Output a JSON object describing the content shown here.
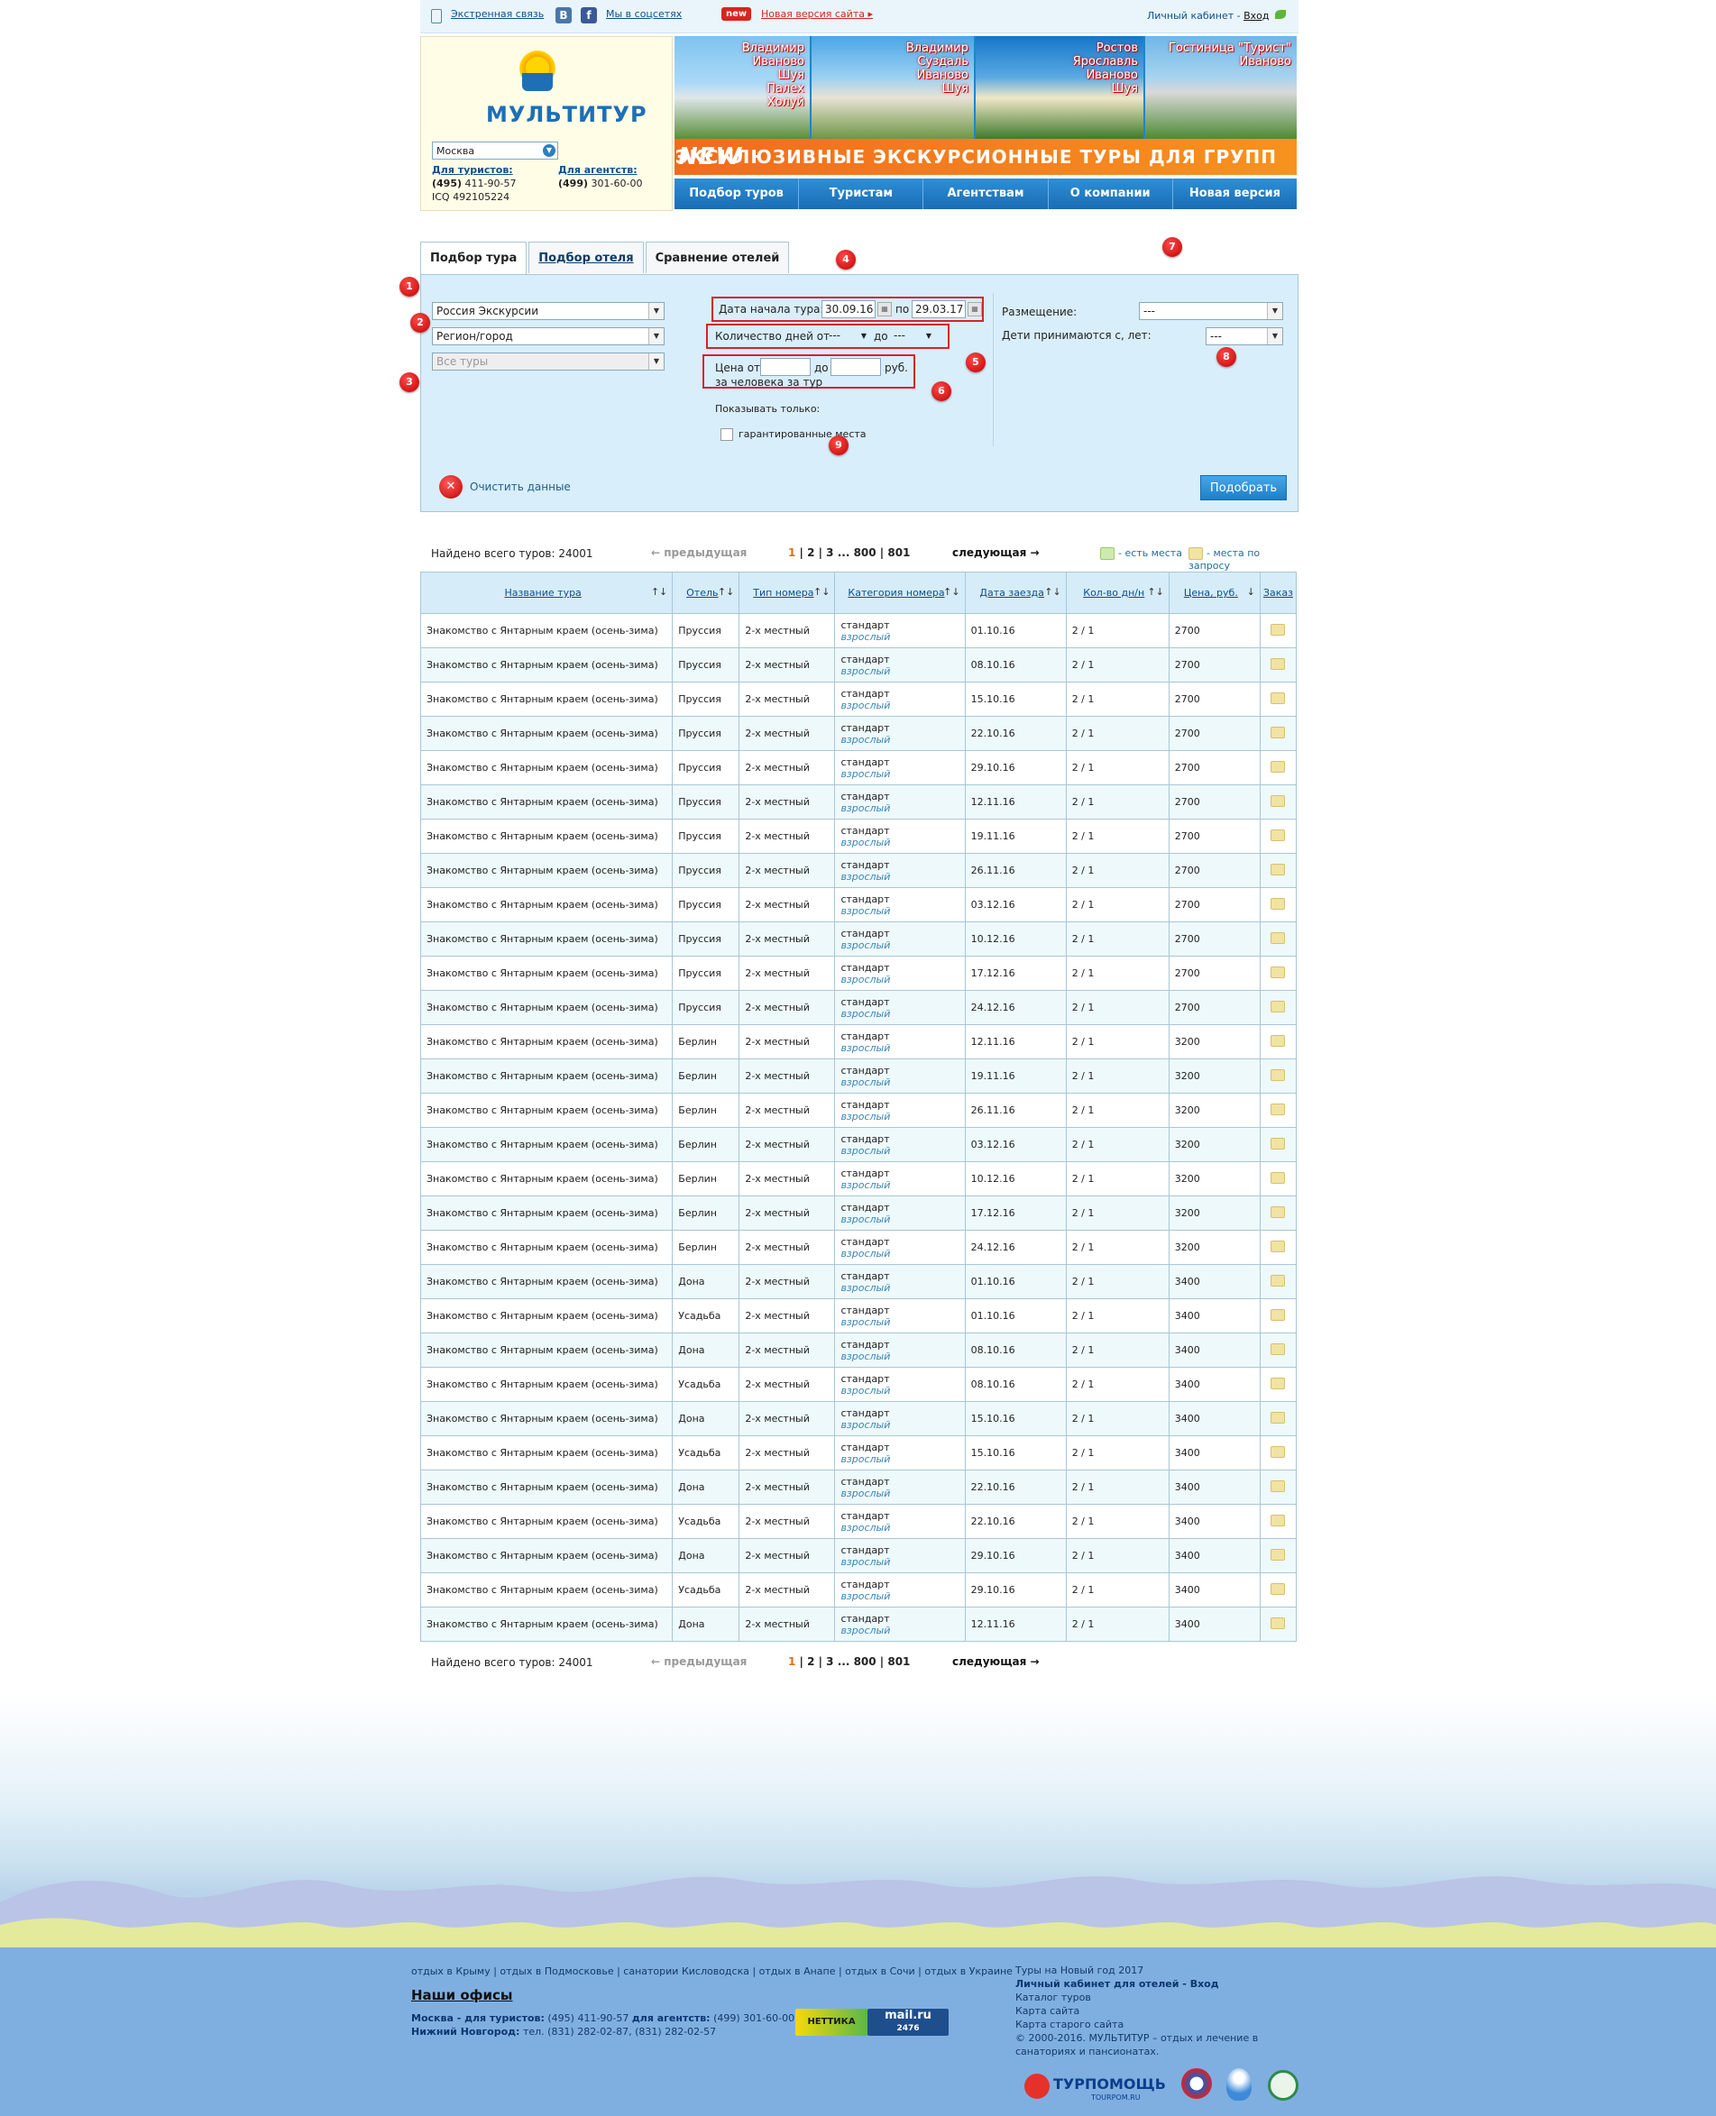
{
  "topbar": {
    "emergency": "Экстренная связь",
    "social": "Мы в соцсетях",
    "vk": "В",
    "fb": "f",
    "new_badge": "new",
    "new_site": "Новая версия сайта",
    "account": "Личный кабинет - ",
    "login": "Вход"
  },
  "header": {
    "logo": "МУЛЬТИТУР",
    "city": "Москва",
    "tourists_label": "Для туристов:",
    "tourists_phone_code": "(495)",
    "tourists_phone": " 411-90-57",
    "icq": "ICQ 492105224",
    "agents_label": "Для агентств:",
    "agents_phone_code": "(499)",
    "agents_phone": " 301-60-00"
  },
  "banner": {
    "photos": [
      "Владимир\nИваново\nШуя\nПалех\nХолуй",
      "Владимир\nСуздаль\nИваново\nШуя",
      "Ростов\nЯрославль\nИваново\nШуя",
      "Гостиница \"Турист\"\nИваново"
    ],
    "new_label": "NEW",
    "slogan": "ЭКСКЛЮЗИВНЫЕ ЭКСКУРСИОННЫЕ ТУРЫ ДЛЯ ГРУПП"
  },
  "nav": [
    "Подбор туров",
    "Туристам",
    "Агентствам",
    "О компании",
    "Новая версия сайта"
  ],
  "tabs": [
    "Подбор тура",
    "Подбор отеля",
    "Сравнение отелей"
  ],
  "search": {
    "country": "Россия Экскурсии",
    "region": "Регион/город",
    "tours": "Все туры",
    "date_label": "Дата начала тура: с",
    "date_from": "30.09.16",
    "date_to_label": "по",
    "date_to": "29.03.17",
    "days_label": "Количество дней от",
    "days_from": "---",
    "days_to_label": "до",
    "days_to": "---",
    "price_label": "Цена от",
    "price_to_label": "до",
    "price_unit": "руб.",
    "price_per": "за человека за тур",
    "show_only": "Показывать только:",
    "guaranteed": "гарантированные места",
    "placement_label": "Размещение:",
    "placement": "---",
    "children_label": "Дети принимаются с, лет:",
    "children": "---",
    "clear": "Очистить данные",
    "submit": "Подобрать",
    "markers": [
      "1",
      "2",
      "3",
      "4",
      "5",
      "6",
      "7",
      "8",
      "9"
    ]
  },
  "pager": {
    "found": "Найдено всего туров: 24001",
    "prev": "← предыдущая",
    "current": "1",
    "pages": " | 2 | 3 ... 800 | 801",
    "next": "следующая →",
    "legend_available": "- есть места",
    "legend_request": "- места по запросу"
  },
  "table": {
    "headers": [
      "Название тура",
      "Отель",
      "Тип номера",
      "Категория номера",
      "Дата заезда",
      "Кол-во дн/н",
      "Цена, руб.",
      "Заказ"
    ],
    "tour_name": "Знакомство с Янтарным краем (осень-зима)",
    "room_type": "2-х местный",
    "category": "стандарт",
    "category_sub": "взрослый",
    "rows": [
      {
        "hotel": "Пруссия",
        "date": "01.10.16",
        "days": "2 / 1",
        "price": "2700"
      },
      {
        "hotel": "Пруссия",
        "date": "08.10.16",
        "days": "2 / 1",
        "price": "2700"
      },
      {
        "hotel": "Пруссия",
        "date": "15.10.16",
        "days": "2 / 1",
        "price": "2700"
      },
      {
        "hotel": "Пруссия",
        "date": "22.10.16",
        "days": "2 / 1",
        "price": "2700"
      },
      {
        "hotel": "Пруссия",
        "date": "29.10.16",
        "days": "2 / 1",
        "price": "2700"
      },
      {
        "hotel": "Пруссия",
        "date": "12.11.16",
        "days": "2 / 1",
        "price": "2700"
      },
      {
        "hotel": "Пруссия",
        "date": "19.11.16",
        "days": "2 / 1",
        "price": "2700"
      },
      {
        "hotel": "Пруссия",
        "date": "26.11.16",
        "days": "2 / 1",
        "price": "2700"
      },
      {
        "hotel": "Пруссия",
        "date": "03.12.16",
        "days": "2 / 1",
        "price": "2700"
      },
      {
        "hotel": "Пруссия",
        "date": "10.12.16",
        "days": "2 / 1",
        "price": "2700"
      },
      {
        "hotel": "Пруссия",
        "date": "17.12.16",
        "days": "2 / 1",
        "price": "2700"
      },
      {
        "hotel": "Пруссия",
        "date": "24.12.16",
        "days": "2 / 1",
        "price": "2700"
      },
      {
        "hotel": "Берлин",
        "date": "12.11.16",
        "days": "2 / 1",
        "price": "3200"
      },
      {
        "hotel": "Берлин",
        "date": "19.11.16",
        "days": "2 / 1",
        "price": "3200"
      },
      {
        "hotel": "Берлин",
        "date": "26.11.16",
        "days": "2 / 1",
        "price": "3200"
      },
      {
        "hotel": "Берлин",
        "date": "03.12.16",
        "days": "2 / 1",
        "price": "3200"
      },
      {
        "hotel": "Берлин",
        "date": "10.12.16",
        "days": "2 / 1",
        "price": "3200"
      },
      {
        "hotel": "Берлин",
        "date": "17.12.16",
        "days": "2 / 1",
        "price": "3200"
      },
      {
        "hotel": "Берлин",
        "date": "24.12.16",
        "days": "2 / 1",
        "price": "3200"
      },
      {
        "hotel": "Дона",
        "date": "01.10.16",
        "days": "2 / 1",
        "price": "3400"
      },
      {
        "hotel": "Усадьба",
        "date": "01.10.16",
        "days": "2 / 1",
        "price": "3400"
      },
      {
        "hotel": "Дона",
        "date": "08.10.16",
        "days": "2 / 1",
        "price": "3400"
      },
      {
        "hotel": "Усадьба",
        "date": "08.10.16",
        "days": "2 / 1",
        "price": "3400"
      },
      {
        "hotel": "Дона",
        "date": "15.10.16",
        "days": "2 / 1",
        "price": "3400"
      },
      {
        "hotel": "Усадьба",
        "date": "15.10.16",
        "days": "2 / 1",
        "price": "3400"
      },
      {
        "hotel": "Дона",
        "date": "22.10.16",
        "days": "2 / 1",
        "price": "3400"
      },
      {
        "hotel": "Усадьба",
        "date": "22.10.16",
        "days": "2 / 1",
        "price": "3400"
      },
      {
        "hotel": "Дона",
        "date": "29.10.16",
        "days": "2 / 1",
        "price": "3400"
      },
      {
        "hotel": "Усадьба",
        "date": "29.10.16",
        "days": "2 / 1",
        "price": "3400"
      },
      {
        "hotel": "Дона",
        "date": "12.11.16",
        "days": "2 / 1",
        "price": "3400"
      }
    ]
  },
  "footer": {
    "seo_links": "отдых в Крыму | отдых в Подмосковье | санатории Кисловодска | отдых в Анапе | отдых в Сочи | отдых в Украине",
    "offices_title": "Наши офисы",
    "moscow_label": "Москва - для туристов:",
    "moscow_phone": " (495) 411-90-57 ",
    "moscow_agents_label": "для агентств:",
    "moscow_agents_phone": " (499) 301-60-00",
    "nn_label": "Нижний Новгород:",
    "nn_phone": " тел. (831) 282-02-87, (831) 282-02-57",
    "newyear": "Туры на Новый год 2017",
    "hotels_cabinet": "Личный кабинет для отелей - Вход",
    "catalog": "Каталог туров",
    "sitemap": "Карта сайта",
    "old_sitemap": "Карта старого сайта",
    "copyright": "© 2000-2016. МУЛЬТИТУР – отдых и лечение в санаториях и пансионатах.",
    "counter1": "НЕТТИКА",
    "counter2": "mail.ru",
    "counter2_num": "2476",
    "turpomosh": "ТУРПОМОЩЬ",
    "turpomosh_sub": "TOURPOM.RU"
  },
  "colors": {
    "accent": "#1a6db4",
    "ribbon": "#f26b1d",
    "marker": "#d8222a",
    "panel": "#d8eefa",
    "footer": "#7fafe0"
  }
}
